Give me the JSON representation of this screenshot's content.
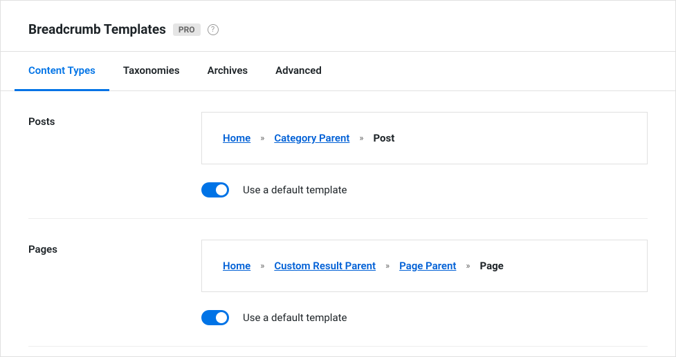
{
  "header": {
    "title": "Breadcrumb Templates",
    "badge": "PRO",
    "help_glyph": "?"
  },
  "tabs": [
    {
      "label": "Content Types",
      "active": true
    },
    {
      "label": "Taxonomies",
      "active": false
    },
    {
      "label": "Archives",
      "active": false
    },
    {
      "label": "Advanced",
      "active": false
    }
  ],
  "sections": [
    {
      "label": "Posts",
      "breadcrumb": [
        {
          "text": "Home",
          "type": "link"
        },
        {
          "text": "Category Parent",
          "type": "link"
        },
        {
          "text": "Post",
          "type": "current"
        }
      ],
      "toggle_label": "Use a default template",
      "toggle_on": true
    },
    {
      "label": "Pages",
      "breadcrumb": [
        {
          "text": "Home",
          "type": "link"
        },
        {
          "text": "Custom Result Parent",
          "type": "link"
        },
        {
          "text": "Page Parent",
          "type": "link"
        },
        {
          "text": "Page",
          "type": "current"
        }
      ],
      "toggle_label": "Use a default template",
      "toggle_on": true
    }
  ],
  "separator_glyph": "»"
}
